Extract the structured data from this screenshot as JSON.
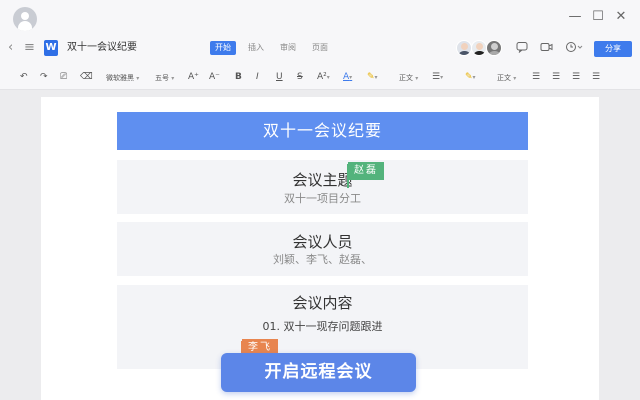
{
  "window": {
    "minimize_icon": "—",
    "maximize_icon": "☐",
    "close_icon": "✕"
  },
  "menubar": {
    "back_icon": "‹",
    "menu_icon": "≡",
    "doc_icon_letter": "W",
    "doc_title": "双十一会议纪要",
    "tabs": [
      {
        "label": "开始",
        "active": true
      },
      {
        "label": "插入",
        "active": false
      },
      {
        "label": "审阅",
        "active": false
      },
      {
        "label": "页面",
        "active": false
      }
    ],
    "share_label": "分享"
  },
  "toolbar": {
    "undo": "↶",
    "redo": "↷",
    "format_painter": "⎚",
    "eraser": "⌫",
    "font_name": "微软雅黑",
    "font_size": "五号",
    "grow_font": "A⁺",
    "shrink_font": "A⁻",
    "bold": "B",
    "italic": "I",
    "underline": "U",
    "strike": "S",
    "superscript": "A²",
    "font_color": "A",
    "highlight": "✎",
    "text_style_1": "正文",
    "line_spacing": "☰",
    "shading": "✎",
    "text_style_2": "正文",
    "align_left": "☰",
    "align_center": "☰",
    "align_right": "☰",
    "justify": "☰"
  },
  "document": {
    "header": "双十一会议纪要",
    "sections": [
      {
        "title": "会议主题",
        "body": "双十一项目分工"
      },
      {
        "title": "会议人员",
        "body": "刘颖、李飞、赵磊、"
      },
      {
        "title": "会议内容",
        "body": "01. 双十一现存问题跟进"
      }
    ]
  },
  "collaborators": {
    "cursor_zhao": {
      "name": "赵磊",
      "color": "#53b37c"
    },
    "cursor_li": {
      "name": "李飞",
      "color": "#e8854f"
    }
  },
  "cta": {
    "label": "开启远程会议"
  },
  "colors": {
    "accent": "#3e7bec",
    "header_bg": "#5f8ff0",
    "cta_bg": "#5c86e8"
  }
}
